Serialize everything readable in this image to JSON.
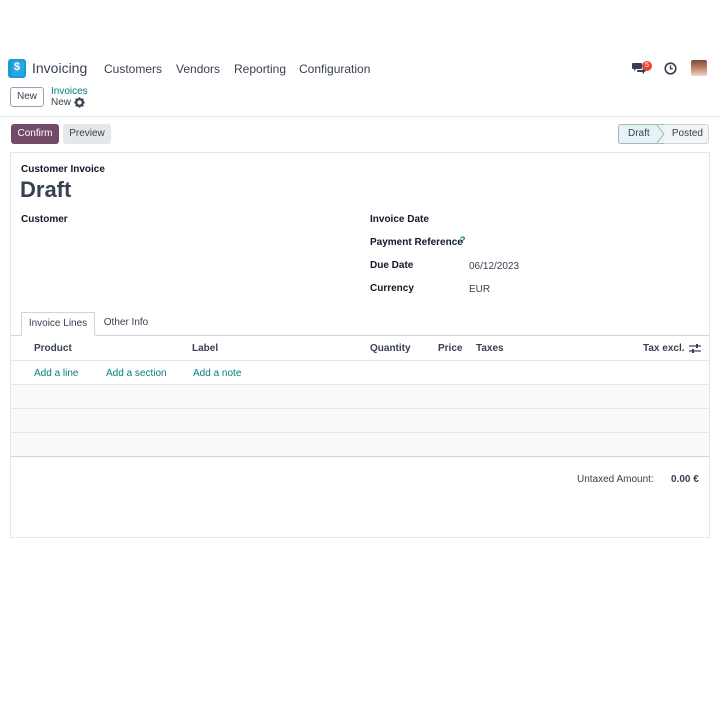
{
  "navbar": {
    "app_name": "Invoicing",
    "menu": [
      "Customers",
      "Vendors",
      "Reporting",
      "Configuration"
    ],
    "messages_badge": "5",
    "icons": {
      "app": "invoicing-app-icon",
      "messages": "chat-bubbles-icon",
      "activities": "clock-icon",
      "user": "avatar"
    },
    "accent": "#1a9ad6"
  },
  "control_panel": {
    "new_label": "New",
    "breadcrumb_parent": "Invoices",
    "breadcrumb_current": "New",
    "settings_icon": "gear-icon"
  },
  "actions": {
    "confirm_label": "Confirm",
    "preview_label": "Preview",
    "primary_color": "#714b67"
  },
  "statusbar": {
    "stages": [
      "Draft",
      "Posted"
    ],
    "active": "Draft"
  },
  "form": {
    "type_label": "Customer Invoice",
    "title": "Draft",
    "customer_label": "Customer",
    "customer_value": "",
    "invoice_date_label": "Invoice Date",
    "invoice_date_value": "",
    "payment_reference_label": "Payment Reference",
    "payment_reference_help": "?",
    "payment_reference_value": "",
    "due_date_label": "Due Date",
    "due_date_value": "06/12/2023",
    "currency_label": "Currency",
    "currency_value": "EUR"
  },
  "tabs": [
    "Invoice Lines",
    "Other Info"
  ],
  "lines": {
    "columns": [
      "Product",
      "Label",
      "Quantity",
      "Price",
      "Taxes",
      "Tax excl."
    ],
    "add_line": "Add a line",
    "add_section": "Add a section",
    "add_note": "Add a note",
    "optional_columns_icon": "sliders-icon"
  },
  "totals": {
    "untaxed_label": "Untaxed Amount:",
    "untaxed_value": "0.00 €"
  }
}
